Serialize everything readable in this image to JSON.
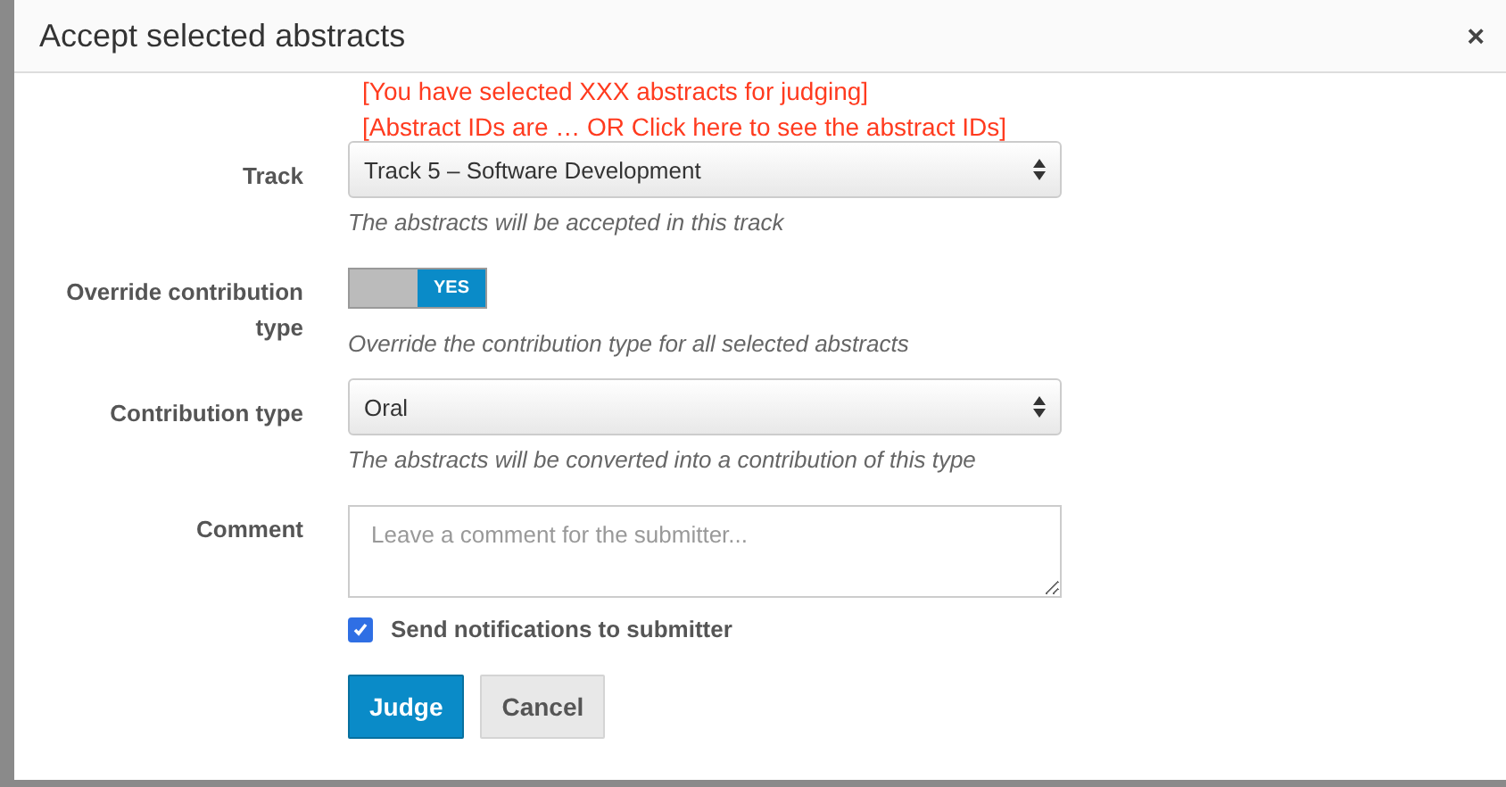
{
  "dialog": {
    "title": "Accept selected abstracts",
    "close": "×"
  },
  "notices": [
    "[You have selected XXX abstracts for judging]",
    "[Abstract IDs are … OR Click here to see the abstract IDs]"
  ],
  "fields": [
    {
      "kind": "select",
      "label": "Track",
      "value": "Track 5 – Software Development",
      "help": "The abstracts will be accepted in this track"
    },
    {
      "kind": "toggle",
      "label": "Override contribution type",
      "on": true,
      "on_text": "YES",
      "help": "Override the contribution type for all selected abstracts"
    },
    {
      "kind": "select",
      "label": "Contribution type",
      "value": "Oral",
      "help": "The abstracts will be converted into a contribution of this type"
    },
    {
      "kind": "textarea",
      "label": "Comment",
      "placeholder": "Leave a comment for the submitter..."
    }
  ],
  "notify": {
    "label": "Send notifications to submitter",
    "checked": true
  },
  "buttons": [
    {
      "label": "Judge",
      "kind": "primary"
    },
    {
      "label": "Cancel",
      "kind": "default"
    }
  ]
}
